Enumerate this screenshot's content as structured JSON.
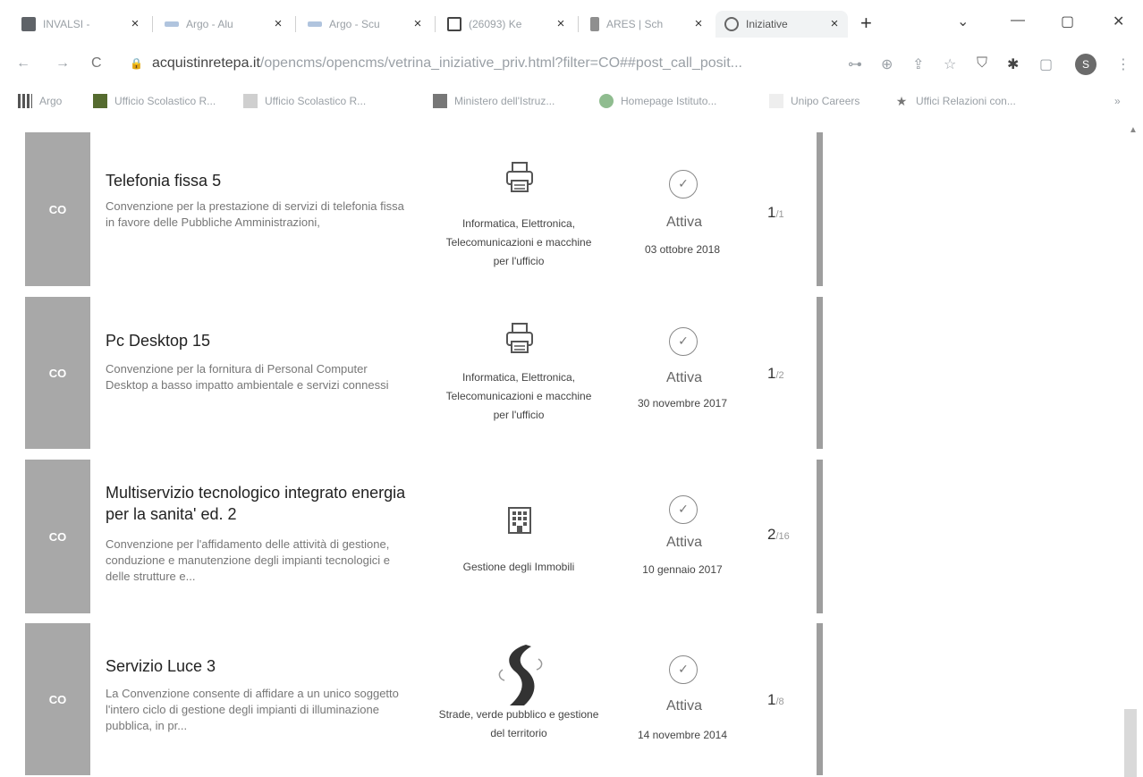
{
  "tabs": [
    {
      "label": "INVALSI - ",
      "favicon_color": "#5f6368"
    },
    {
      "label": "Argo - Alu",
      "favicon_color": "#b0c4de"
    },
    {
      "label": "Argo - Scu",
      "favicon_color": "#b0c4de"
    },
    {
      "label": "(26093) Ke",
      "favicon_color": "#444444"
    },
    {
      "label": "ARES | Sch",
      "favicon_color": "#8f8f8f"
    },
    {
      "label": "Iniziative",
      "favicon_color": "#666666"
    }
  ],
  "tab_close": "×",
  "new_tab": "+",
  "window_controls": {
    "menu": "⌄",
    "minimize": "—",
    "maximize": "▢",
    "close": "✕"
  },
  "address": {
    "back": "←",
    "forward": "→",
    "reload": "C",
    "lock": "🔒",
    "domain": "acquistinretepa.it",
    "path": "/opencms/opencms/vetrina_iniziative_priv.html?filter=CO##post_call_posit...",
    "profile_initial": "S"
  },
  "bookmarks": [
    {
      "label": "Argo",
      "icon_color": "#555555"
    },
    {
      "label": "Ufficio Scolastico R...",
      "icon_color": "#556b2f"
    },
    {
      "label": "Ufficio Scolastico R...",
      "icon_color": "#999999"
    },
    {
      "label": "Ministero dell'Istruz...",
      "icon_color": "#777777"
    },
    {
      "label": "Homepage Istituto...",
      "icon_color": "#8fbc8f"
    },
    {
      "label": "Unipo Careers",
      "icon_color": "#dddddd"
    },
    {
      "label": "Uffici Relazioni con...",
      "icon_color": "#888888"
    }
  ],
  "bookmarks_more": "»",
  "cards": [
    {
      "badge": "CO",
      "title": "Telefonia fissa 5",
      "description": "Convenzione per la prestazione di servizi di telefonia fissa in favore delle Pubbliche Amministrazioni,",
      "category_icon": "printer-icon",
      "category": "Informatica, Elettronica, Telecomunicazioni e macchine per l'ufficio",
      "status": "Attiva",
      "date": "03 ottobre 2018",
      "lots_current": "1",
      "lots_total": "/1"
    },
    {
      "badge": "CO",
      "title": "Pc Desktop 15",
      "description": "Convenzione per la fornitura di Personal Computer Desktop a basso impatto ambientale e servizi connessi",
      "category_icon": "printer-icon",
      "category": "Informatica, Elettronica, Telecomunicazioni e macchine per l'ufficio",
      "status": "Attiva",
      "date": "30 novembre 2017",
      "lots_current": "1",
      "lots_total": "/2"
    },
    {
      "badge": "CO",
      "title": "Multiservizio tecnologico integrato energia per la sanita' ed. 2",
      "description": "Convenzione per l'affidamento delle attività di gestione, conduzione e manutenzione degli impianti tecnologici e delle strutture e...",
      "category_icon": "building-icon",
      "category": "Gestione degli Immobili",
      "status": "Attiva",
      "date": "10 gennaio 2017",
      "lots_current": "2",
      "lots_total": "/16"
    },
    {
      "badge": "CO",
      "title": "Servizio Luce 3",
      "description": "La Convenzione consente di affidare a un unico soggetto l'intero ciclo di gestione degli impianti di illuminazione pubblica, in pr...",
      "category_icon": "road-icon",
      "category": "Strade, verde pubblico e gestione del territorio",
      "status": "Attiva",
      "date": "14 novembre 2014",
      "lots_current": "1",
      "lots_total": "/8"
    }
  ],
  "status_check": "✓",
  "scroll_up": "▲"
}
